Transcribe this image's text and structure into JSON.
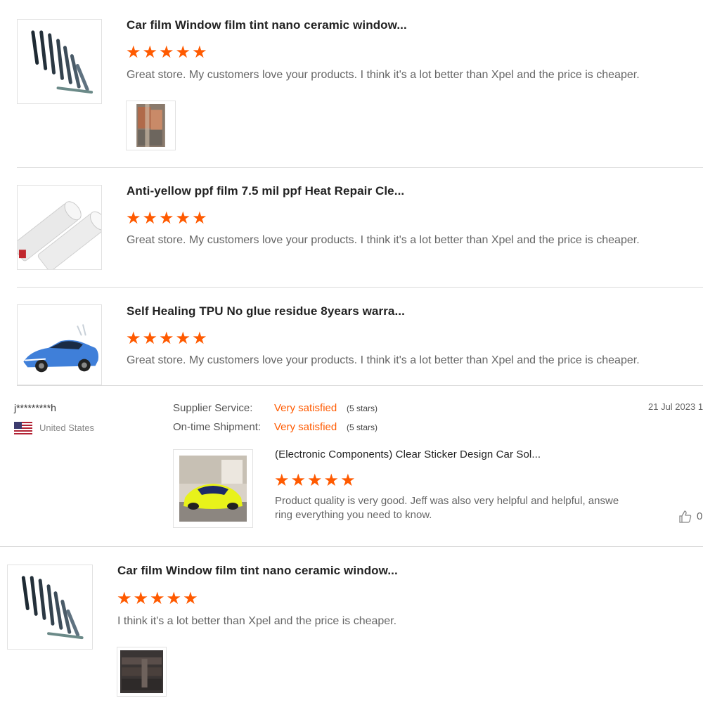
{
  "reviews_top": [
    {
      "title": "Car film Window film tint nano ceramic window...",
      "stars": 5,
      "text": "Great store. My customers love your products. I think it's a lot better than Xpel and the price is cheaper.",
      "thumb_icon": "film-rolls-image",
      "has_photo": true
    },
    {
      "title": "Anti-yellow ppf film 7.5 mil ppf Heat Repair Cle...",
      "stars": 5,
      "text": "Great store. My customers love your products. I think it's a lot better than Xpel and the price is cheaper.",
      "thumb_icon": "ppf-roll-image"
    },
    {
      "title": "Self Healing TPU No glue residue 8years warra...",
      "stars": 5,
      "text": "Great store. My customers love your products. I think it's a lot better than Xpel and the price is cheaper.",
      "thumb_icon": "blue-car-image"
    }
  ],
  "buyer": {
    "name": "j*********h",
    "country": "United States",
    "flag_icon": "us-flag-icon",
    "date": "21 Jul 2023 1",
    "supplier_service_label": "Supplier Service:",
    "supplier_service_value": "Very satisfied",
    "supplier_service_note": "(5 stars)",
    "shipment_label": "On-time Shipment:",
    "shipment_value": "Very satisfied",
    "shipment_note": "(5 stars)",
    "product_title": "(Electronic Components) Clear Sticker Design Car Sol...",
    "stars": 5,
    "text_line1": "Product quality is very good. Jeff was also very helpful and helpful, answe",
    "text_line2": "ring everything you need to know.",
    "likes": "0",
    "like_icon": "thumbs-up-icon"
  },
  "review_bottom": {
    "title": "Car film Window film tint nano ceramic window...",
    "stars": 5,
    "text": "I think it's a lot better than Xpel and the price is cheaper.",
    "thumb_icon": "film-rolls-image"
  },
  "star_glyph": "★",
  "colors": {
    "accent": "#ff5a00",
    "divider": "#d9d9d9"
  }
}
